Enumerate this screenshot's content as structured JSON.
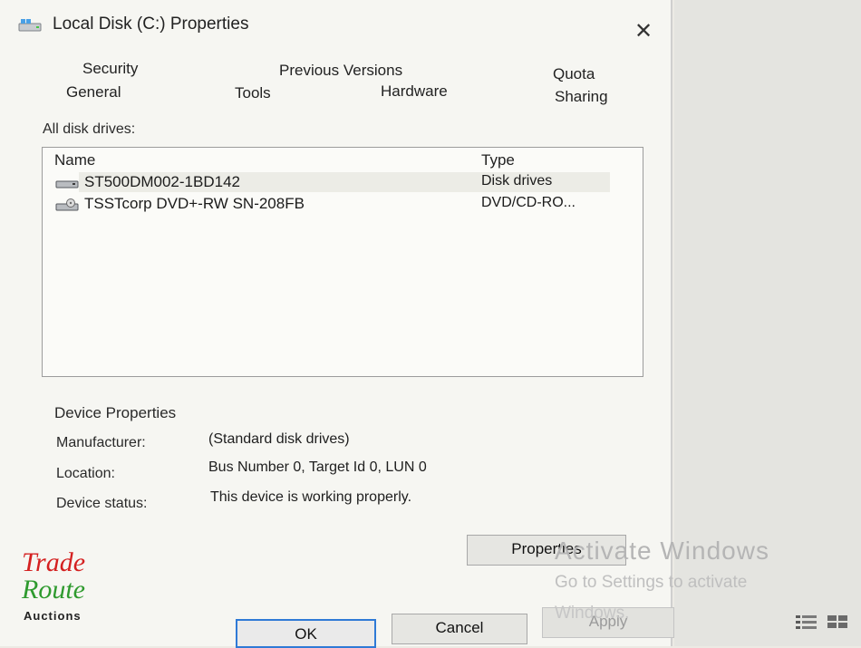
{
  "window": {
    "title": "Local Disk (C:) Properties",
    "close_glyph": "✕"
  },
  "tabs": {
    "row1": [
      {
        "label": "Security"
      },
      {
        "label": "Previous Versions"
      },
      {
        "label": "Quota"
      }
    ],
    "row2": [
      {
        "label": "General"
      },
      {
        "label": "Tools"
      },
      {
        "label": "Hardware"
      },
      {
        "label": "Sharing"
      }
    ]
  },
  "drives": {
    "section_label": "All disk drives:",
    "columns": {
      "name": "Name",
      "type": "Type"
    },
    "rows": [
      {
        "name": "ST500DM002-1BD142",
        "type": "Disk drives",
        "icon": "hard-disk-icon"
      },
      {
        "name": "TSSTcorp DVD+-RW SN-208FB",
        "type": "DVD/CD-RO...",
        "icon": "optical-drive-icon"
      }
    ]
  },
  "device_properties": {
    "heading": "Device Properties",
    "manufacturer_label": "Manufacturer:",
    "manufacturer_value": "(Standard disk drives)",
    "location_label": "Location:",
    "location_value": "Bus Number 0, Target Id 0, LUN 0",
    "status_label": "Device status:",
    "status_value": "This device is working properly.",
    "properties_button": "Properties"
  },
  "buttons": {
    "ok": "OK",
    "cancel": "Cancel",
    "apply": "Apply"
  },
  "activation": {
    "line1": "Activate Windows",
    "line2": "Go to Settings to activate",
    "line3": "Windows."
  },
  "logo": {
    "line1": "Trade",
    "line2": "Route",
    "line3": "Auctions"
  },
  "colors": {
    "accent": "#2f7ad6",
    "logo_red": "#d42020",
    "logo_green": "#2e9a2e"
  }
}
